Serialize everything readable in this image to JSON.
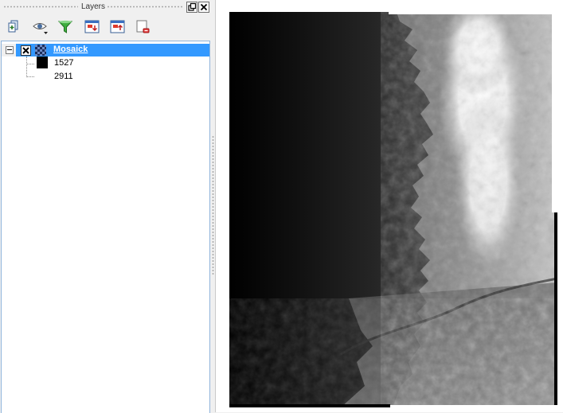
{
  "dock": {
    "title": "Layers",
    "toolbar": [
      {
        "icon": "add-group-icon"
      },
      {
        "icon": "visibility-icon"
      },
      {
        "icon": "filter-icon"
      },
      {
        "icon": "expand-all-icon"
      },
      {
        "icon": "collapse-all-icon"
      },
      {
        "icon": "remove-layer-icon"
      }
    ],
    "float_icon": "float-window-icon",
    "close_icon": "close-icon"
  },
  "layers": {
    "group": {
      "name": "Mosaick",
      "checked": true,
      "expanded": true,
      "selected": true
    },
    "legend": [
      {
        "label": "1527",
        "color": "#000000"
      },
      {
        "label": "2911",
        "color": "#ffffff"
      }
    ]
  },
  "colors": {
    "selection": "#3399ff",
    "tree_border": "#8fb4db",
    "raster_low": "#000000",
    "raster_high": "#ffffff"
  }
}
